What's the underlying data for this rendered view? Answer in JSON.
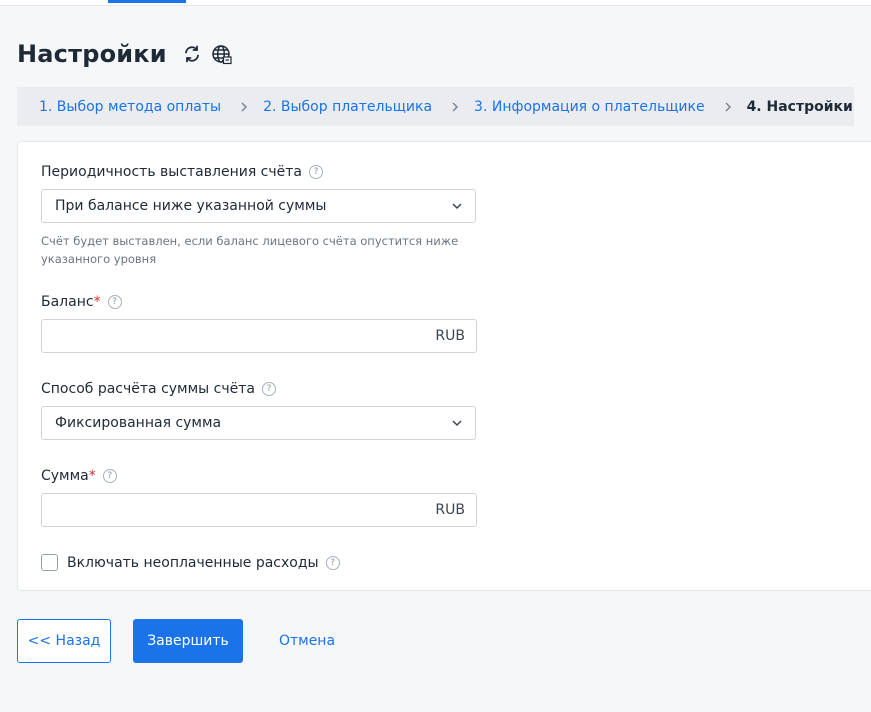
{
  "page": {
    "title": "Настройки"
  },
  "icons": {
    "refresh": "refresh-icon",
    "globe": "globe-icon"
  },
  "breadcrumb": [
    {
      "label": "1. Выбор метода оплаты"
    },
    {
      "label": "2. Выбор плательщика"
    },
    {
      "label": "3. Информация о плательщике"
    },
    {
      "label": "4. Настройки"
    }
  ],
  "form": {
    "periodicity": {
      "label": "Периодичность выставления счёта",
      "value": "При балансе ниже указанной суммы",
      "hint": "Счёт будет выставлен, если баланс лицевого счёта опустится ниже указанного уровня"
    },
    "balance": {
      "label": "Баланс",
      "required": "*",
      "value": "",
      "currency": "RUB"
    },
    "calc_method": {
      "label": "Способ расчёта суммы счёта",
      "value": "Фиксированная сумма"
    },
    "amount": {
      "label": "Сумма",
      "required": "*",
      "value": "",
      "currency": "RUB"
    },
    "unpaid_expenses": {
      "label": "Включать неоплаченные расходы",
      "checked": false
    }
  },
  "actions": {
    "back": "<< Назад",
    "finish": "Завершить",
    "cancel": "Отмена"
  },
  "colors": {
    "accent": "#1a73e8",
    "required": "#d32f2f",
    "background": "#f6f7f8"
  }
}
